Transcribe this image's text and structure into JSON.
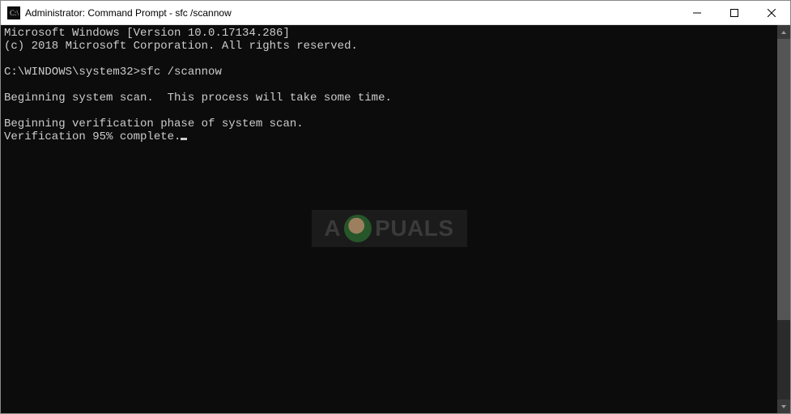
{
  "window": {
    "title": "Administrator: Command Prompt - sfc  /scannow"
  },
  "console": {
    "line1": "Microsoft Windows [Version 10.0.17134.286]",
    "line2": "(c) 2018 Microsoft Corporation. All rights reserved.",
    "blank1": "",
    "prompt": "C:\\WINDOWS\\system32>",
    "command": "sfc /scannow",
    "blank2": "",
    "line3": "Beginning system scan.  This process will take some time.",
    "blank3": "",
    "line4": "Beginning verification phase of system scan.",
    "line5": "Verification 95% complete."
  },
  "watermark": {
    "prefix": "A",
    "suffix": "PUALS"
  }
}
